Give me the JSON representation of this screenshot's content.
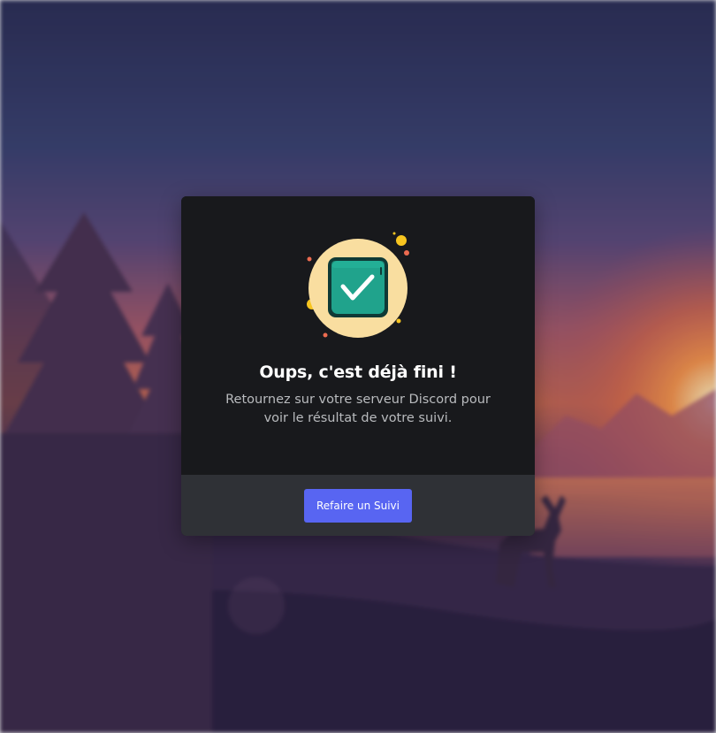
{
  "modal": {
    "title": "Oups, c'est déjà fini !",
    "description": "Retournez sur votre serveur Discord pour voir le résultat de votre suivi.",
    "button_label": "Refaire un Suivi",
    "illustration_icon": "checkbox-check-icon"
  },
  "colors": {
    "modal_background": "#18191c",
    "footer_background": "#2f3136",
    "button": "#5865f2",
    "icon_circle": "#f9dea0",
    "icon_box": "#20a38c"
  }
}
